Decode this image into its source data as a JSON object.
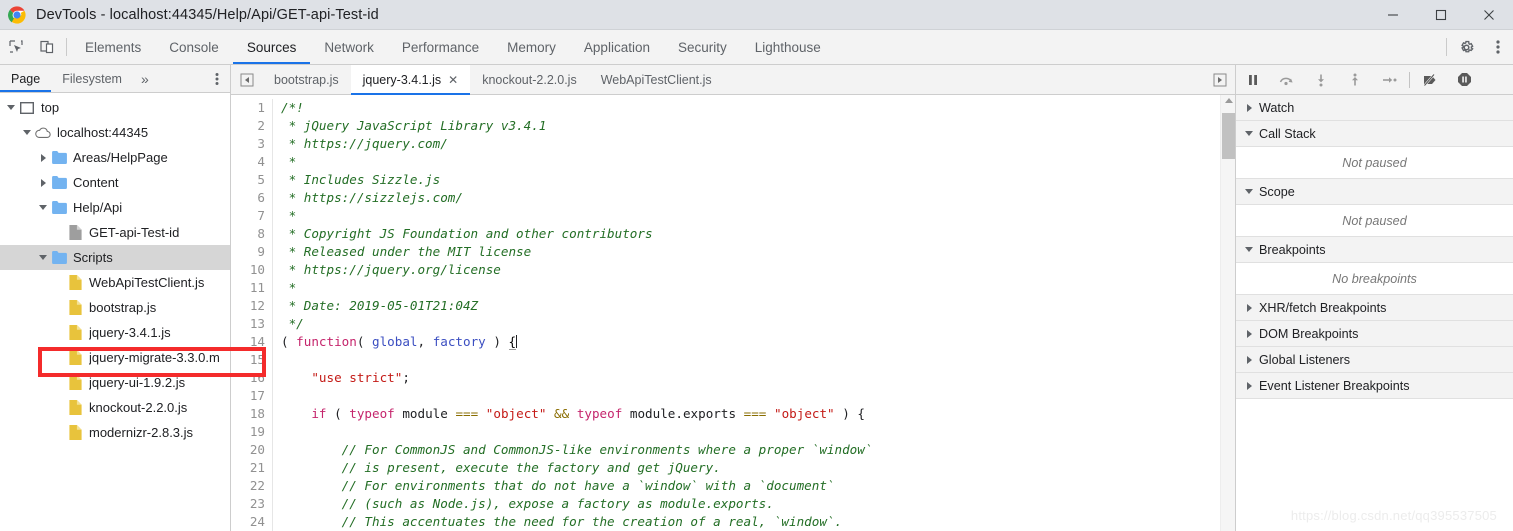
{
  "window": {
    "title": "DevTools - localhost:44345/Help/Api/GET-api-Test-id",
    "minimize_label": "—",
    "maximize_label": "□",
    "close_label": "✕"
  },
  "devtools_tabs": {
    "inspect_icon": "inspect-element-icon",
    "device_icon": "device-toolbar-icon",
    "items": [
      {
        "label": "Elements",
        "active": false
      },
      {
        "label": "Console",
        "active": false
      },
      {
        "label": "Sources",
        "active": true
      },
      {
        "label": "Network",
        "active": false
      },
      {
        "label": "Performance",
        "active": false
      },
      {
        "label": "Memory",
        "active": false
      },
      {
        "label": "Application",
        "active": false
      },
      {
        "label": "Security",
        "active": false
      },
      {
        "label": "Lighthouse",
        "active": false
      }
    ],
    "settings_icon": "gear-icon",
    "menu_icon": "kebab-menu-icon"
  },
  "navigator": {
    "tabs": [
      {
        "label": "Page",
        "active": true
      },
      {
        "label": "Filesystem",
        "active": false
      }
    ],
    "more_label": "»",
    "kebab_icon": "kebab-menu-icon",
    "tree": [
      {
        "label": "top",
        "indent": 0,
        "twisty": "down",
        "icon": "frame-icon",
        "selected": false
      },
      {
        "label": "localhost:44345",
        "indent": 1,
        "twisty": "down",
        "icon": "cloud-icon",
        "selected": false
      },
      {
        "label": "Areas/HelpPage",
        "indent": 2,
        "twisty": "right",
        "icon": "folder-icon",
        "selected": false
      },
      {
        "label": "Content",
        "indent": 2,
        "twisty": "right",
        "icon": "folder-icon",
        "selected": false
      },
      {
        "label": "Help/Api",
        "indent": 2,
        "twisty": "down",
        "icon": "folder-icon",
        "selected": false
      },
      {
        "label": "GET-api-Test-id",
        "indent": 3,
        "twisty": "none",
        "icon": "document-icon",
        "selected": false
      },
      {
        "label": "Scripts",
        "indent": 2,
        "twisty": "down",
        "icon": "folder-icon",
        "selected": true
      },
      {
        "label": "WebApiTestClient.js",
        "indent": 3,
        "twisty": "none",
        "icon": "js-file-icon",
        "selected": false
      },
      {
        "label": "bootstrap.js",
        "indent": 3,
        "twisty": "none",
        "icon": "js-file-icon",
        "selected": false
      },
      {
        "label": "jquery-3.4.1.js",
        "indent": 3,
        "twisty": "none",
        "icon": "js-file-icon",
        "selected": false
      },
      {
        "label": "jquery-migrate-3.3.0.m",
        "indent": 3,
        "twisty": "none",
        "icon": "js-file-icon",
        "selected": false
      },
      {
        "label": "jquery-ui-1.9.2.js",
        "indent": 3,
        "twisty": "none",
        "icon": "js-file-icon",
        "selected": false
      },
      {
        "label": "knockout-2.2.0.js",
        "indent": 3,
        "twisty": "none",
        "icon": "js-file-icon",
        "selected": false
      },
      {
        "label": "modernizr-2.8.3.js",
        "indent": 3,
        "twisty": "none",
        "icon": "js-file-icon",
        "selected": false
      }
    ],
    "highlight_color": "#f42b2b"
  },
  "editor": {
    "scroll_left_icon": "scroll-tabs-left-icon",
    "scroll_right_icon": "scroll-tabs-right-icon",
    "tabs": [
      {
        "label": "bootstrap.js",
        "active": false,
        "closable": false
      },
      {
        "label": "jquery-3.4.1.js",
        "active": true,
        "closable": true,
        "close_label": "✕"
      },
      {
        "label": "knockout-2.2.0.js",
        "active": false,
        "closable": false
      },
      {
        "label": "WebApiTestClient.js",
        "active": false,
        "closable": false
      }
    ],
    "lines": [
      {
        "n": "1",
        "tokens": [
          {
            "t": "/*!",
            "c": "cm"
          }
        ]
      },
      {
        "n": "2",
        "tokens": [
          {
            "t": " * jQuery JavaScript Library v3.4.1",
            "c": "cm"
          }
        ]
      },
      {
        "n": "3",
        "tokens": [
          {
            "t": " * https://jquery.com/",
            "c": "cm"
          }
        ]
      },
      {
        "n": "4",
        "tokens": [
          {
            "t": " *",
            "c": "cm"
          }
        ]
      },
      {
        "n": "5",
        "tokens": [
          {
            "t": " * Includes Sizzle.js",
            "c": "cm"
          }
        ]
      },
      {
        "n": "6",
        "tokens": [
          {
            "t": " * https://sizzlejs.com/",
            "c": "cm"
          }
        ]
      },
      {
        "n": "7",
        "tokens": [
          {
            "t": " *",
            "c": "cm"
          }
        ]
      },
      {
        "n": "8",
        "tokens": [
          {
            "t": " * Copyright JS Foundation and other contributors",
            "c": "cm"
          }
        ]
      },
      {
        "n": "9",
        "tokens": [
          {
            "t": " * Released under the MIT license",
            "c": "cm"
          }
        ]
      },
      {
        "n": "10",
        "tokens": [
          {
            "t": " * https://jquery.org/license",
            "c": "cm"
          }
        ]
      },
      {
        "n": "11",
        "tokens": [
          {
            "t": " *",
            "c": "cm"
          }
        ]
      },
      {
        "n": "12",
        "tokens": [
          {
            "t": " * Date: 2019-05-01T21:04Z",
            "c": "cm"
          }
        ]
      },
      {
        "n": "13",
        "tokens": [
          {
            "t": " */",
            "c": "cm"
          }
        ]
      },
      {
        "n": "14",
        "tokens": [
          {
            "t": "( ",
            "c": "cpl"
          },
          {
            "t": "function",
            "c": "ckw"
          },
          {
            "t": "( ",
            "c": "cpl"
          },
          {
            "t": "global",
            "c": "cvar"
          },
          {
            "t": ", ",
            "c": "cpl"
          },
          {
            "t": "factory",
            "c": "cvar"
          },
          {
            "t": " ) ",
            "c": "cpl"
          },
          {
            "t": "{",
            "c": "cbrace"
          }
        ]
      },
      {
        "n": "15",
        "tokens": [
          {
            "t": "",
            "c": "cpl"
          }
        ]
      },
      {
        "n": "16",
        "tokens": [
          {
            "t": "\t",
            "c": "cpl"
          },
          {
            "t": "\"use strict\"",
            "c": "cstr"
          },
          {
            "t": ";",
            "c": "cpl"
          }
        ]
      },
      {
        "n": "17",
        "tokens": [
          {
            "t": "",
            "c": "cpl"
          }
        ]
      },
      {
        "n": "18",
        "tokens": [
          {
            "t": "\t",
            "c": "cpl"
          },
          {
            "t": "if",
            "c": "ckw"
          },
          {
            "t": " ( ",
            "c": "cpl"
          },
          {
            "t": "typeof",
            "c": "ckw"
          },
          {
            "t": " module ",
            "c": "cpl"
          },
          {
            "t": "===",
            "c": "cop"
          },
          {
            "t": " ",
            "c": "cpl"
          },
          {
            "t": "\"object\"",
            "c": "cstr"
          },
          {
            "t": " ",
            "c": "cpl"
          },
          {
            "t": "&&",
            "c": "cop"
          },
          {
            "t": " ",
            "c": "cpl"
          },
          {
            "t": "typeof",
            "c": "ckw"
          },
          {
            "t": " module.exports ",
            "c": "cpl"
          },
          {
            "t": "===",
            "c": "cop"
          },
          {
            "t": " ",
            "c": "cpl"
          },
          {
            "t": "\"object\"",
            "c": "cstr"
          },
          {
            "t": " ) {",
            "c": "cpl"
          }
        ]
      },
      {
        "n": "19",
        "tokens": [
          {
            "t": "",
            "c": "cpl"
          }
        ]
      },
      {
        "n": "20",
        "tokens": [
          {
            "t": "\t\t// For CommonJS and CommonJS-like environments where a proper `window`",
            "c": "cm"
          }
        ]
      },
      {
        "n": "21",
        "tokens": [
          {
            "t": "\t\t// is present, execute the factory and get jQuery.",
            "c": "cm"
          }
        ]
      },
      {
        "n": "22",
        "tokens": [
          {
            "t": "\t\t// For environments that do not have a `window` with a `document`",
            "c": "cm"
          }
        ]
      },
      {
        "n": "23",
        "tokens": [
          {
            "t": "\t\t// (such as Node.js), expose a factory as module.exports.",
            "c": "cm"
          }
        ]
      },
      {
        "n": "24",
        "tokens": [
          {
            "t": "\t\t// This accentuates the need for the creation of a real, `window`.",
            "c": "cm"
          }
        ]
      }
    ]
  },
  "debugger": {
    "toolbar": [
      {
        "icon": "pause-script-icon",
        "name": "pause-resume-button"
      },
      {
        "icon": "step-over-icon",
        "name": "step-over-button"
      },
      {
        "icon": "step-into-icon",
        "name": "step-into-button"
      },
      {
        "icon": "step-out-icon",
        "name": "step-out-button"
      },
      {
        "icon": "step-icon",
        "name": "step-button"
      },
      {
        "icon": "separator",
        "name": "toolbar-separator"
      },
      {
        "icon": "deactivate-breakpoints-icon",
        "name": "deactivate-breakpoints-button"
      },
      {
        "icon": "pause-on-exceptions-icon",
        "name": "pause-on-exceptions-button"
      }
    ],
    "sections": [
      {
        "label": "Watch",
        "expanded": false,
        "body": null
      },
      {
        "label": "Call Stack",
        "expanded": true,
        "body": "Not paused"
      },
      {
        "label": "Scope",
        "expanded": true,
        "body": "Not paused"
      },
      {
        "label": "Breakpoints",
        "expanded": true,
        "body": "No breakpoints"
      },
      {
        "label": "XHR/fetch Breakpoints",
        "expanded": false,
        "body": null
      },
      {
        "label": "DOM Breakpoints",
        "expanded": false,
        "body": null
      },
      {
        "label": "Global Listeners",
        "expanded": false,
        "body": null
      },
      {
        "label": "Event Listener Breakpoints",
        "expanded": false,
        "body": null
      }
    ]
  },
  "watermark": "https://blog.csdn.net/qq395537505"
}
